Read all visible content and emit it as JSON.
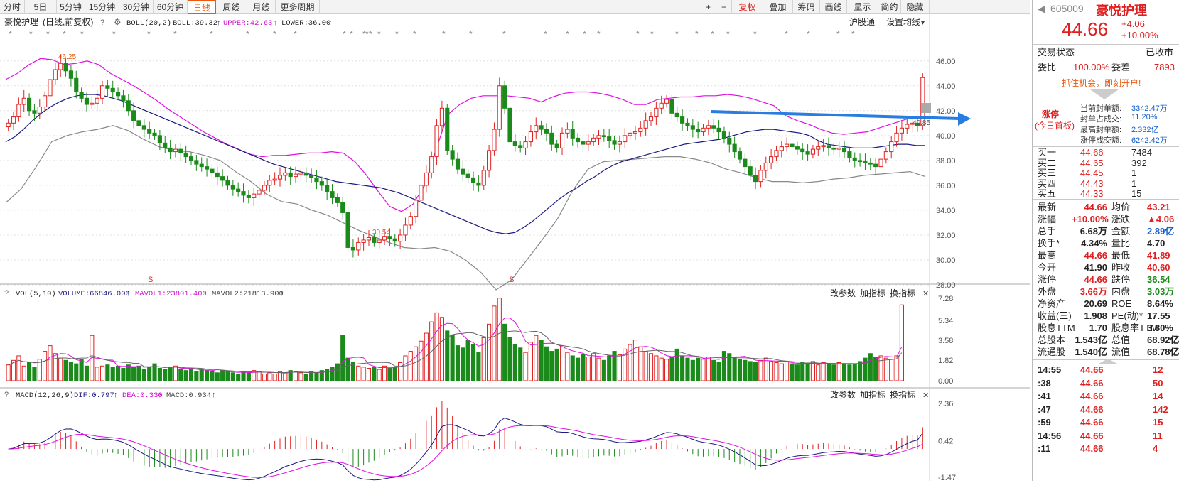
{
  "toolbar": {
    "periods": [
      "分时",
      "5日",
      "5分钟",
      "15分钟",
      "30分钟",
      "60分钟",
      "日线",
      "周线",
      "月线",
      "更多周期"
    ],
    "active": "日线",
    "right": [
      "+",
      "−",
      "复权",
      "叠加",
      "筹码",
      "画线",
      "显示",
      "简约",
      "隐藏"
    ]
  },
  "chart_header": {
    "name": "豪悦护理",
    "mode": "(日线,前复权)",
    "boll_label": "BOLL(20,2)",
    "boll_val": "BOLL:39.32",
    "upper_val": "UPPER:42.63",
    "lower_val": "LOWER:36.00",
    "links": [
      "沪股通",
      "设置均线"
    ]
  },
  "price_axis": {
    "ticks": [
      "46.00",
      "44.00",
      "42.00",
      "40.00",
      "38.00",
      "36.00",
      "34.00",
      "32.00",
      "30.00",
      "28.00"
    ],
    "ylim": [
      27.2,
      46.9
    ]
  },
  "price_annotations": {
    "high": "46.25",
    "low": "30.54",
    "cur": "40.85"
  },
  "vol_header": {
    "label": "VOL(5,10)",
    "volume": "VOLUME:66846.000",
    "mavol1": "MAVOL1:23801.400",
    "mavol2": "MAVOL2:21813.900",
    "links": [
      "改参数",
      "加指标",
      "换指标"
    ]
  },
  "vol_axis": {
    "ticks": [
      "7.28",
      "5.34",
      "3.58",
      "1.82",
      "0.00"
    ]
  },
  "macd_header": {
    "label": "MACD(12,26,9)",
    "dif": "DIF:0.797",
    "dea": "DEA:0.330",
    "macd": "MACD:0.934",
    "links": [
      "改参数",
      "加指标",
      "换指标"
    ]
  },
  "macd_axis": {
    "ticks": [
      "2.36",
      "0.42",
      "-1.47"
    ]
  },
  "stock": {
    "code": "605009",
    "name": "豪悦护理",
    "price": "44.66",
    "change": "+4.06",
    "pct": "+10.00%"
  },
  "status": {
    "label": "交易状态",
    "value": "已收市",
    "weibi_label": "委比",
    "weibi": "100.00%",
    "weicha_label": "委差",
    "weicha": "7893",
    "promo": "抓住机会，即刻开户!"
  },
  "limit": {
    "tag1": "涨停",
    "tag2": "(今日首板)",
    "rows": [
      [
        "当前封单额:",
        "3342.47万"
      ],
      [
        "封单占成交:",
        "11.20%"
      ],
      [
        "最高封单额:",
        "2.332亿"
      ],
      [
        "涨停成交额:",
        "6242.42万"
      ]
    ]
  },
  "orders": [
    [
      "买一",
      "44.66",
      "7484"
    ],
    [
      "买二",
      "44.65",
      "392"
    ],
    [
      "买三",
      "44.45",
      "1"
    ],
    [
      "买四",
      "44.43",
      "1"
    ],
    [
      "买五",
      "44.33",
      "15"
    ]
  ],
  "stats": [
    [
      "最新",
      "44.66",
      "均价",
      "43.21"
    ],
    [
      "涨幅",
      "+10.00%",
      "涨跌",
      "▲4.06"
    ],
    [
      "总手",
      "6.68万",
      "金额",
      "2.89亿"
    ],
    [
      "换手*",
      "4.34%",
      "量比",
      "4.70"
    ],
    [
      "最高",
      "44.66",
      "最低",
      "41.89"
    ],
    [
      "今开",
      "41.90",
      "昨收",
      "40.60"
    ],
    [
      "涨停",
      "44.66",
      "跌停",
      "36.54"
    ],
    [
      "外盘",
      "3.66万",
      "内盘",
      "3.03万"
    ],
    [
      "净资产",
      "20.69",
      "ROE",
      "8.64%"
    ],
    [
      "收益(三)",
      "1.908",
      "PE(动)*",
      "17.55"
    ],
    [
      "股息TTM",
      "1.70",
      "股息率TTM",
      "3.80%"
    ],
    [
      "总股本",
      "1.543亿",
      "总值",
      "68.92亿"
    ],
    [
      "流通股",
      "1.540亿",
      "流值",
      "68.78亿"
    ]
  ],
  "ticks": [
    [
      "14:55",
      "44.66",
      "12"
    ],
    [
      ":38",
      "44.66",
      "50"
    ],
    [
      ":41",
      "44.66",
      "14"
    ],
    [
      ":47",
      "44.66",
      "142"
    ],
    [
      ":59",
      "44.66",
      "15"
    ],
    [
      "14:56",
      "44.66",
      "11"
    ],
    [
      ":11",
      "44.66",
      "4"
    ]
  ],
  "chart_data": {
    "type": "candlestick",
    "ylim": [
      27.2,
      46.9
    ],
    "closes": [
      41.0,
      41.5,
      42.5,
      43.0,
      42.0,
      41.8,
      42.3,
      43.2,
      44.5,
      45.3,
      45.8,
      45.2,
      44.6,
      43.5,
      43.0,
      42.5,
      42.6,
      43.0,
      44.0,
      43.8,
      43.5,
      43.2,
      42.8,
      42.0,
      41.2,
      40.8,
      40.5,
      40.2,
      40.0,
      39.4,
      39.0,
      38.7,
      38.9,
      38.6,
      38.3,
      38.0,
      37.7,
      37.5,
      37.3,
      37.0,
      36.7,
      36.4,
      36.0,
      35.7,
      35.5,
      35.2,
      35.0,
      35.3,
      35.6,
      36.0,
      36.4,
      36.5,
      36.8,
      37.0,
      36.7,
      36.9,
      37.0,
      36.8,
      36.6,
      36.3,
      36.0,
      35.5,
      35.0,
      34.6,
      33.8,
      31.0,
      30.8,
      31.4,
      31.6,
      31.8,
      31.4,
      31.6,
      31.9,
      31.7,
      31.5,
      32.0,
      32.8,
      33.5,
      34.8,
      36.0,
      37.0,
      38.3,
      40.8,
      42.2,
      38.8,
      38.1,
      37.3,
      36.9,
      36.6,
      36.2,
      36.0,
      37.2,
      38.8,
      40.5,
      44.0,
      42.2,
      39.5,
      39.2,
      39.0,
      39.5,
      40.3,
      40.8,
      40.5,
      40.2,
      39.3,
      39.0,
      40.2,
      40.5,
      39.8,
      39.5,
      39.3,
      39.5,
      39.8,
      40.0,
      39.9,
      39.6,
      39.3,
      39.5,
      40.0,
      40.2,
      40.3,
      40.6,
      41.2,
      41.5,
      42.2,
      42.6,
      42.9,
      41.8,
      41.5,
      41.0,
      40.8,
      40.5,
      40.3,
      40.6,
      40.8,
      40.6,
      40.3,
      39.8,
      39.3,
      38.7,
      38.1,
      37.5,
      36.8,
      36.3,
      37.2,
      37.8,
      38.3,
      38.8,
      39.1,
      39.3,
      39.1,
      38.9,
      38.7,
      38.5,
      38.9,
      39.1,
      39.2,
      39.0,
      38.9,
      39.0,
      38.7,
      38.2,
      38.0,
      37.9,
      37.8,
      37.7,
      37.5,
      38.1,
      38.7,
      39.5,
      40.2,
      40.6,
      40.9,
      41.0,
      40.8,
      44.66
    ],
    "volumes": [
      1.4,
      1.8,
      2.2,
      1.3,
      1.6,
      1.2,
      1.9,
      2.6,
      3.1,
      2.4,
      2.0,
      1.8,
      1.6,
      1.5,
      1.9,
      1.3,
      4.0,
      1.2,
      1.3,
      1.4,
      1.2,
      1.3,
      1.1,
      1.4,
      1.2,
      1.3,
      1.0,
      1.2,
      1.5,
      1.1,
      1.0,
      1.2,
      1.3,
      1.0,
      0.9,
      1.1,
      0.8,
      1.0,
      0.9,
      0.8,
      0.7,
      0.9,
      0.8,
      0.7,
      0.6,
      0.8,
      0.7,
      0.9,
      0.8,
      0.6,
      0.7,
      0.6,
      0.8,
      0.7,
      0.9,
      0.8,
      0.7,
      0.6,
      0.8,
      0.7,
      0.9,
      1.0,
      1.2,
      1.5,
      4.0,
      2.0,
      1.6,
      1.3,
      1.2,
      1.1,
      1.2,
      1.0,
      1.3,
      1.1,
      1.2,
      1.6,
      2.2,
      2.6,
      3.0,
      3.5,
      4.2,
      5.2,
      6.0,
      5.6,
      4.4,
      4.0,
      3.1,
      2.9,
      3.6,
      3.2,
      2.5,
      3.8,
      5.0,
      6.6,
      7.3,
      5.0,
      3.8,
      3.2,
      2.9,
      2.5,
      3.4,
      4.0,
      3.6,
      3.0,
      2.6,
      2.8,
      3.1,
      2.5,
      2.2,
      2.0,
      2.3,
      2.1,
      2.4,
      2.0,
      1.8,
      2.2,
      2.6,
      2.3,
      2.8,
      3.2,
      3.6,
      3.0,
      2.6,
      2.4,
      2.2,
      2.0,
      1.9,
      2.1,
      2.8,
      2.2,
      2.0,
      1.8,
      2.0,
      1.9,
      2.1,
      1.8,
      1.6,
      2.6,
      2.4,
      2.1,
      1.9,
      1.8,
      1.7,
      1.6,
      1.8,
      2.0,
      1.7,
      1.6,
      1.5,
      1.7,
      1.5,
      1.4,
      1.6,
      1.5,
      1.7,
      1.4,
      1.6,
      1.5,
      1.4,
      1.6,
      1.5,
      1.4,
      1.5,
      1.7,
      2.0,
      2.4,
      2.1,
      2.2,
      2.0,
      1.9,
      2.2,
      6.7
    ],
    "boll_mid": [
      39.5,
      39.9,
      40.5,
      41.2,
      41.8,
      42.3,
      42.7,
      43.0,
      43.2,
      43.3,
      43.3,
      43.2,
      43.0,
      42.8,
      42.5,
      42.2,
      41.9,
      41.6,
      41.3,
      41.0,
      40.7,
      40.4,
      40.1,
      39.8,
      39.5,
      39.2,
      38.9,
      38.6,
      38.3,
      38.0,
      37.7,
      37.5,
      37.3,
      37.1,
      36.9,
      36.7,
      36.5,
      36.3,
      36.2,
      36.1,
      36.0,
      35.9,
      35.8,
      35.6,
      35.4,
      35.1,
      34.8,
      34.5,
      34.2,
      33.9,
      33.6,
      33.3,
      33.0,
      32.7,
      32.4,
      32.2,
      32.1,
      32.2,
      32.6,
      33.1,
      33.7,
      34.3,
      34.9,
      35.4,
      35.8,
      36.3,
      36.7,
      37.2,
      37.6,
      37.9,
      38.1,
      38.3,
      38.5,
      38.7,
      38.9,
      39.1,
      39.3,
      39.4,
      39.5,
      39.6,
      39.7,
      39.9,
      40.1,
      40.3,
      40.4,
      40.5,
      40.5,
      40.4,
      40.3,
      40.2,
      40.0,
      39.6,
      39.3,
      39.2,
      39.1,
      39.0,
      39.0,
      39.0,
      39.1,
      39.2,
      39.3,
      39.3,
      39.2,
      39.2
    ],
    "boll_upper": [
      44.5,
      45.0,
      45.7,
      46.2,
      46.1,
      45.7,
      45.8,
      46.0,
      45.7,
      45.0,
      44.5,
      44.0,
      43.4,
      42.8,
      42.1,
      41.5,
      40.9,
      40.3,
      39.8,
      39.3,
      38.9,
      38.5,
      38.3,
      38.4,
      38.4,
      38.5,
      38.6,
      38.6,
      38.7,
      38.6,
      37.9,
      36.8,
      35.5,
      34.3,
      33.9,
      34.5,
      36.0,
      39.0,
      41.7,
      42.5,
      43.0,
      43.2,
      43.2,
      43.2,
      43.1,
      43.0,
      42.7,
      43.1,
      43.4,
      43.5,
      43.5,
      43.4,
      43.2,
      42.9,
      42.5,
      42.5,
      42.9,
      43.0,
      43.1,
      43.1,
      43.2,
      43.2,
      43.3,
      43.2,
      43.0,
      42.7,
      42.4,
      41.6,
      41.2,
      40.9,
      40.5,
      40.2,
      40.1,
      40.2,
      40.3,
      40.6,
      40.9,
      41.2,
      41.5,
      41.6
    ],
    "boll_lower": [
      34.6,
      35.7,
      37.5,
      39.5,
      40.0,
      40.3,
      40.5,
      40.8,
      40.4,
      39.7,
      39.1,
      38.8,
      38.7,
      38.4,
      38.0,
      37.1,
      36.3,
      35.3,
      34.7,
      34.5,
      34.0,
      33.6,
      33.0,
      32.4,
      31.9,
      31.4,
      31.0,
      30.9,
      31.0,
      30.7,
      30.0,
      29.0,
      27.6,
      28.4,
      30.0,
      31.6,
      33.3,
      35.6,
      37.3,
      37.9,
      38.0,
      38.1,
      38.2,
      38.3,
      38.3,
      38.1,
      37.8,
      37.3,
      37.0,
      36.6,
      36.3,
      36.3,
      36.2,
      36.3,
      36.5,
      36.6,
      36.8,
      36.9,
      37.0,
      37.1,
      36.7
    ]
  }
}
